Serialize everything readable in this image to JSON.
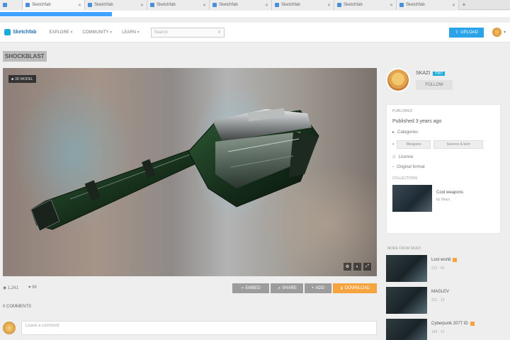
{
  "browser": {
    "tabs": [
      {
        "label": "",
        "active": false
      },
      {
        "label": "Sketchfab",
        "active": true
      },
      {
        "label": "Sketchfab",
        "active": false
      },
      {
        "label": "Sketchfab",
        "active": false
      },
      {
        "label": "Sketchfab",
        "active": false
      },
      {
        "label": "Sketchfab",
        "active": false
      },
      {
        "label": "Sketchfab",
        "active": false
      },
      {
        "label": "Sketchfab",
        "active": false
      }
    ],
    "new_tab": "+",
    "load_progress": 0.22
  },
  "header": {
    "logo": "Sketchfab",
    "nav": [
      "EXPLORE",
      "COMMUNITY",
      "LEARN"
    ],
    "search_placeholder": "Search",
    "upload_label": "UPLOAD"
  },
  "model": {
    "title": "SHOCKBLAST",
    "viewer_badge": "3D MODEL",
    "stats": {
      "views": "1,261",
      "likes": "96"
    },
    "actions": [
      "EMBED",
      "SHARE",
      "ADD",
      "DOWNLOAD"
    ]
  },
  "comments": {
    "heading": "0 COMMENTS",
    "placeholder": "Leave a comment"
  },
  "author": {
    "name": "SKAZI",
    "badge": "PRO",
    "follow_label": "FOLLOW"
  },
  "info": {
    "label": "PUBLISHED",
    "line": "Published 3 years ago",
    "category_label": "Categories",
    "chips": [
      "Weapons",
      "Science & tech"
    ],
    "license": "License",
    "format": "Original format",
    "collections_label": "COLLECTIONS",
    "collection": {
      "name": "Cool weapons",
      "sub": "by Skazi"
    }
  },
  "more": {
    "heading": "MORE FROM SKAZI",
    "items": [
      {
        "title": "Lost world",
        "meta": "312 · 40"
      },
      {
        "title": "MAGLEV",
        "meta": "221 · 19"
      },
      {
        "title": "Cyberpunk 2077 ID",
        "meta": "184 · 12"
      }
    ]
  },
  "colors": {
    "accent": "#2aa3e8",
    "download": "#f5a440",
    "pro_badge": "#1caad9"
  },
  "icons": {
    "search": "search-icon",
    "upload": "upload-icon",
    "fullscreen": "fullscreen-icon",
    "settings": "gear-icon"
  }
}
